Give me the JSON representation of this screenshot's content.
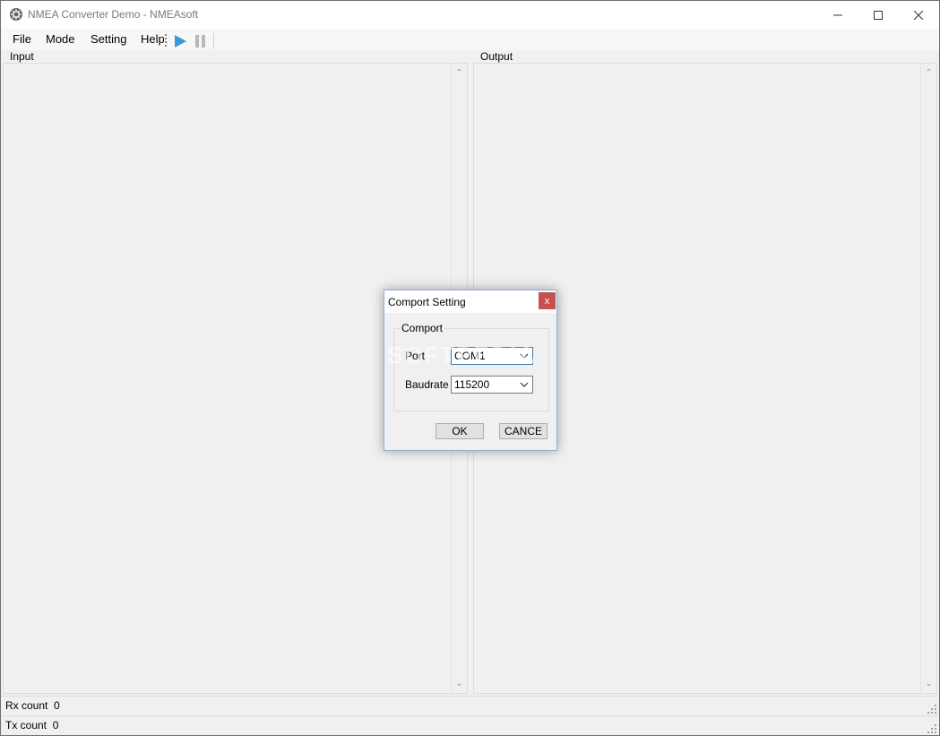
{
  "window": {
    "title": "NMEA Converter Demo - NMEAsoft",
    "icon": "gear-wheel-icon",
    "controls": {
      "minimize": "minimize-icon",
      "maximize": "maximize-icon",
      "close": "close-icon"
    }
  },
  "menu": {
    "items": [
      {
        "label": "File"
      },
      {
        "label": "Mode"
      },
      {
        "label": "Setting"
      },
      {
        "label": "Help"
      }
    ]
  },
  "toolbar": {
    "play_icon": "play-icon",
    "pause_icon": "pause-icon",
    "colors": {
      "play": "#3a9ad9",
      "pause": "#b8b8b8"
    }
  },
  "panels": {
    "input_label": "Input",
    "output_label": "Output"
  },
  "status": {
    "rx_label": "Rx count",
    "rx_value": "0",
    "tx_label": "Tx count",
    "tx_value": "0"
  },
  "dialog": {
    "title": "Comport Setting",
    "close_label": "x",
    "group_label": "Comport",
    "port_label": "Port",
    "port_value": "COM1",
    "baud_label": "Baudrate",
    "baud_value": "115200",
    "ok_label": "OK",
    "cancel_label": "CANCE",
    "colors": {
      "close_bg": "#c75050",
      "focus_border": "#3c7fb1"
    }
  },
  "watermark": "SOFTPEDIA"
}
